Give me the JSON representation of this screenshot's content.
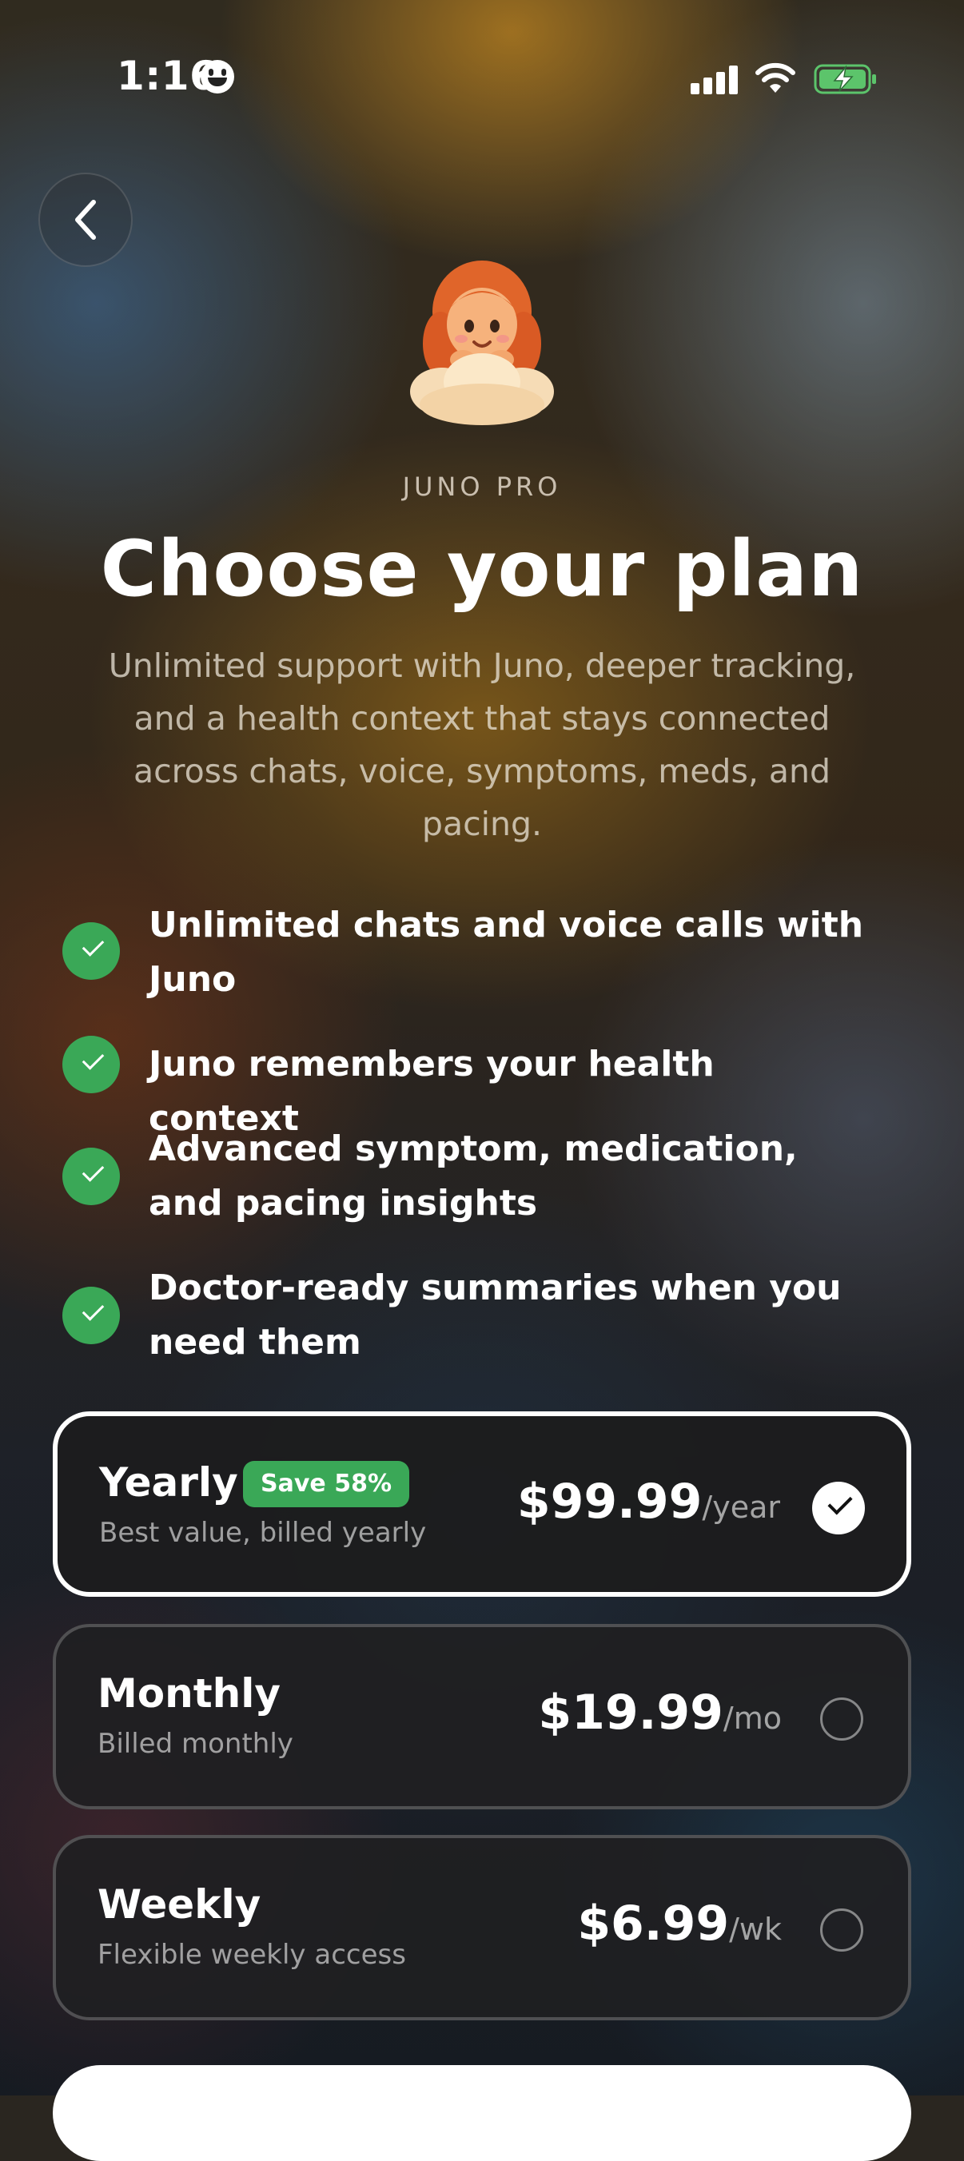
{
  "status_bar": {
    "time": "1:16"
  },
  "header": {
    "back_icon": "chevron-left-icon"
  },
  "hero": {
    "eyebrow": "JUNO PRO",
    "title": "Choose your plan",
    "subtitle": "Unlimited support with Juno, deeper tracking, and a health context that stays connected across chats, voice, symptoms, meds, and pacing."
  },
  "features": [
    "Unlimited chats and voice calls with Juno",
    "Juno remembers your health context",
    "Advanced symptom, medication, and pacing insights",
    "Doctor-ready summaries when you need them"
  ],
  "plans": [
    {
      "name": "Yearly",
      "badge": "Save 58%",
      "description": "Best value, billed yearly",
      "price": "$99.99",
      "unit": "/year",
      "selected": true
    },
    {
      "name": "Monthly",
      "description": "Billed monthly",
      "price": "$19.99",
      "unit": "/mo",
      "selected": false
    },
    {
      "name": "Weekly",
      "description": "Flexible weekly access",
      "price": "$6.99",
      "unit": "/wk",
      "selected": false
    }
  ],
  "colors": {
    "accent_green": "#3aa857",
    "selected_border": "#ffffff",
    "card_bg": "#202022"
  }
}
